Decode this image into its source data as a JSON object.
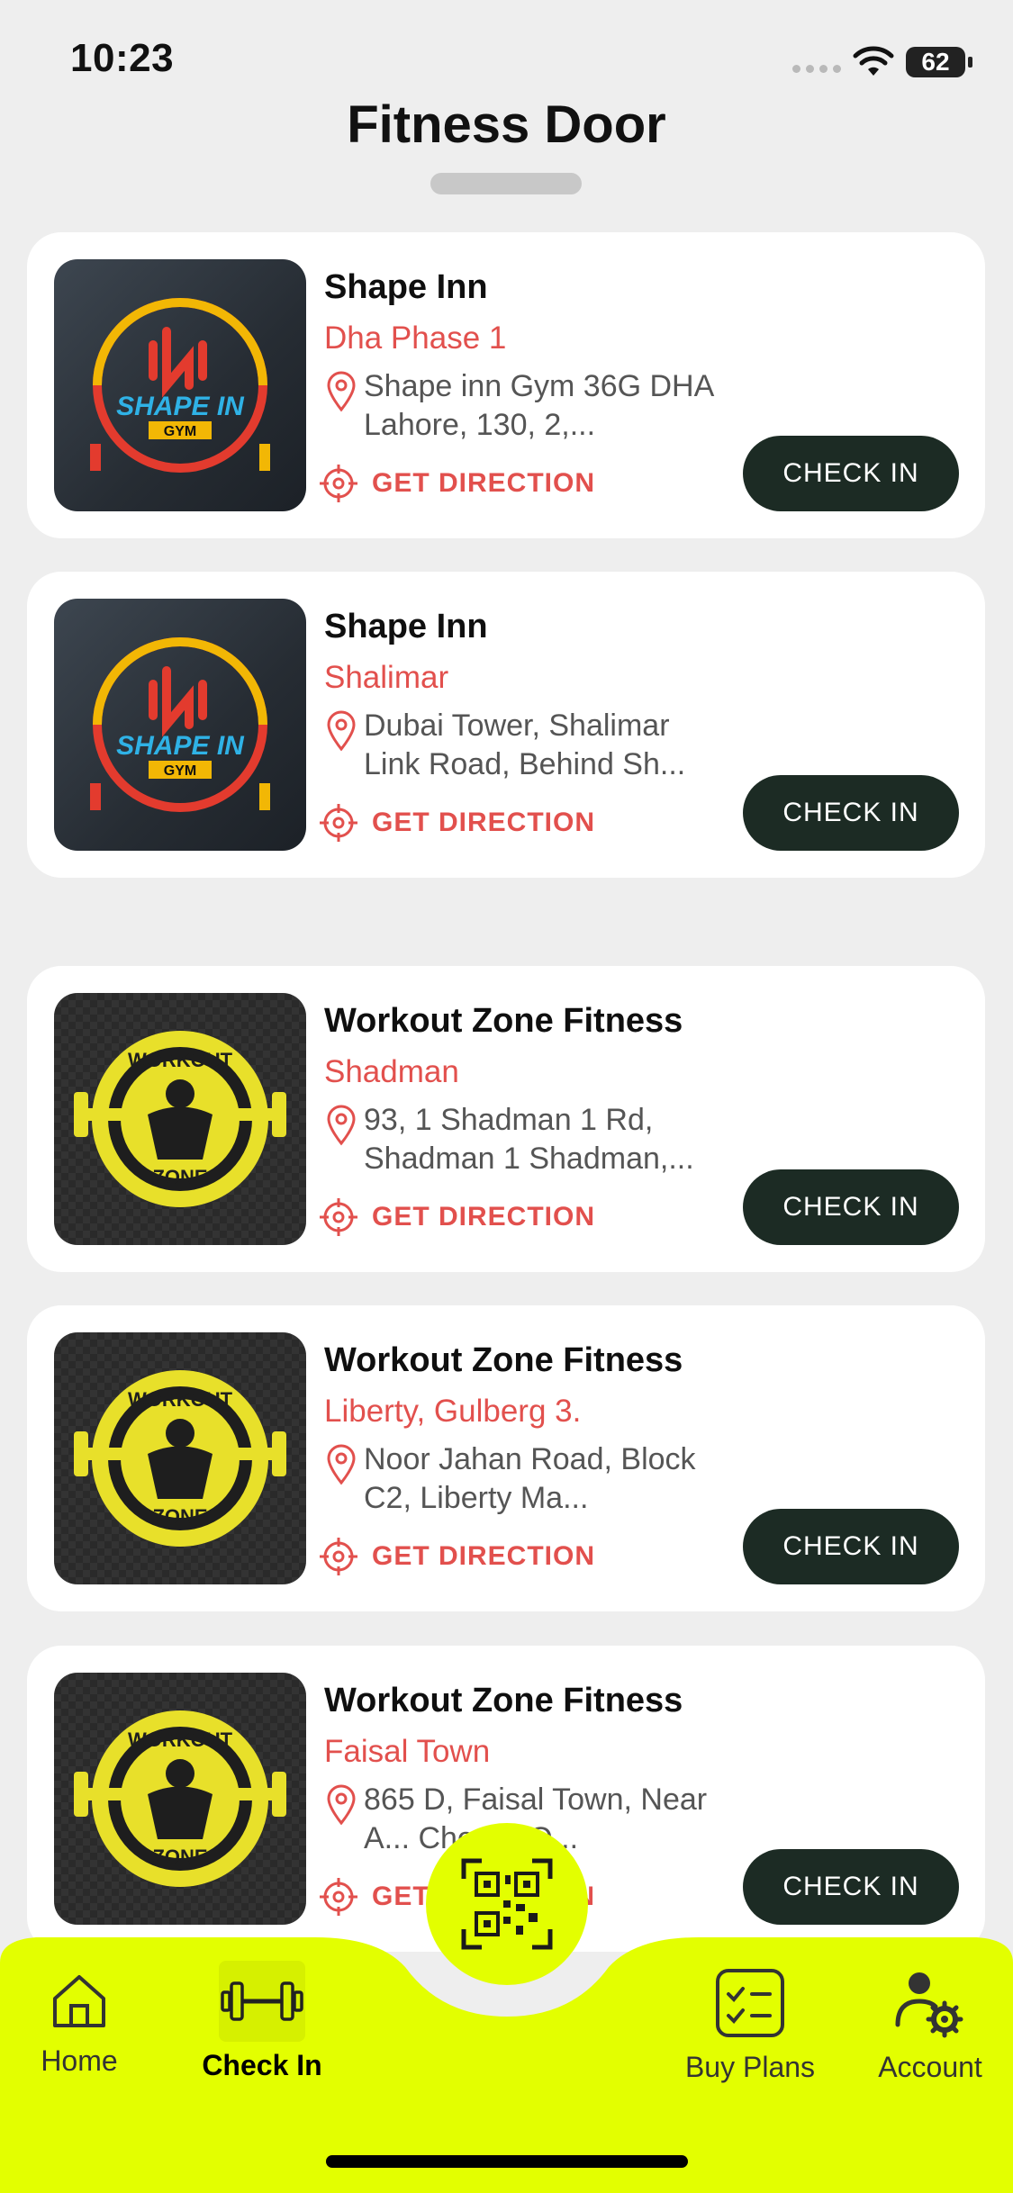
{
  "status": {
    "time": "10:23",
    "battery": "62"
  },
  "header": {
    "title": "Fitness Door"
  },
  "gyms": [
    {
      "name": "Shape Inn",
      "branch": "Dha Phase 1",
      "address": "Shape inn Gym 36G DHA Lahore, 130, 2,...",
      "direction_label": "GET DIRECTION",
      "checkin_label": "CHECK IN",
      "logo": "shape-inn-logo"
    },
    {
      "name": "Shape Inn",
      "branch": "Shalimar",
      "address": "Dubai Tower, Shalimar Link Road, Behind Sh...",
      "direction_label": "GET DIRECTION",
      "checkin_label": "CHECK IN",
      "logo": "shape-inn-logo"
    },
    {
      "name": "Workout Zone Fitness",
      "branch": "Shadman",
      "address": "93, 1 Shadman 1 Rd, Shadman 1 Shadman,...",
      "direction_label": "GET DIRECTION",
      "checkin_label": "CHECK IN",
      "logo": "workout-zone-logo"
    },
    {
      "name": "Workout Zone Fitness",
      "branch": "Liberty, Gulberg 3.",
      "address": "Noor Jahan Road, Block C2, Liberty Ma...",
      "direction_label": "GET DIRECTION",
      "checkin_label": "CHECK IN",
      "logo": "workout-zone-logo"
    },
    {
      "name": "Workout Zone Fitness",
      "branch": "Faisal Town",
      "address": "865 D, Faisal Town, Near A... Chowk, O...",
      "direction_label": "GET DIRECTION",
      "checkin_label": "CHECK IN",
      "logo": "workout-zone-logo"
    }
  ],
  "logo_text": {
    "shape_inn": "SHAPE IN",
    "shape_inn_sub": "GYM",
    "workout_zone_top": "WORKOUT",
    "workout_zone_bottom": "ZONE"
  },
  "bottom_nav": {
    "items": [
      {
        "label": "Home",
        "icon": "home-icon"
      },
      {
        "label": "Check In",
        "icon": "dumbbell-icon",
        "active": true
      },
      {
        "label": "Buy Plans",
        "icon": "checklist-icon"
      },
      {
        "label": "Account",
        "icon": "user-settings-icon"
      }
    ],
    "fab_icon": "qr-code-icon"
  },
  "colors": {
    "accent": "#e3ff00",
    "branch_red": "#e2504d",
    "button_dark": "#1c2b24",
    "background": "#eeeeee"
  }
}
